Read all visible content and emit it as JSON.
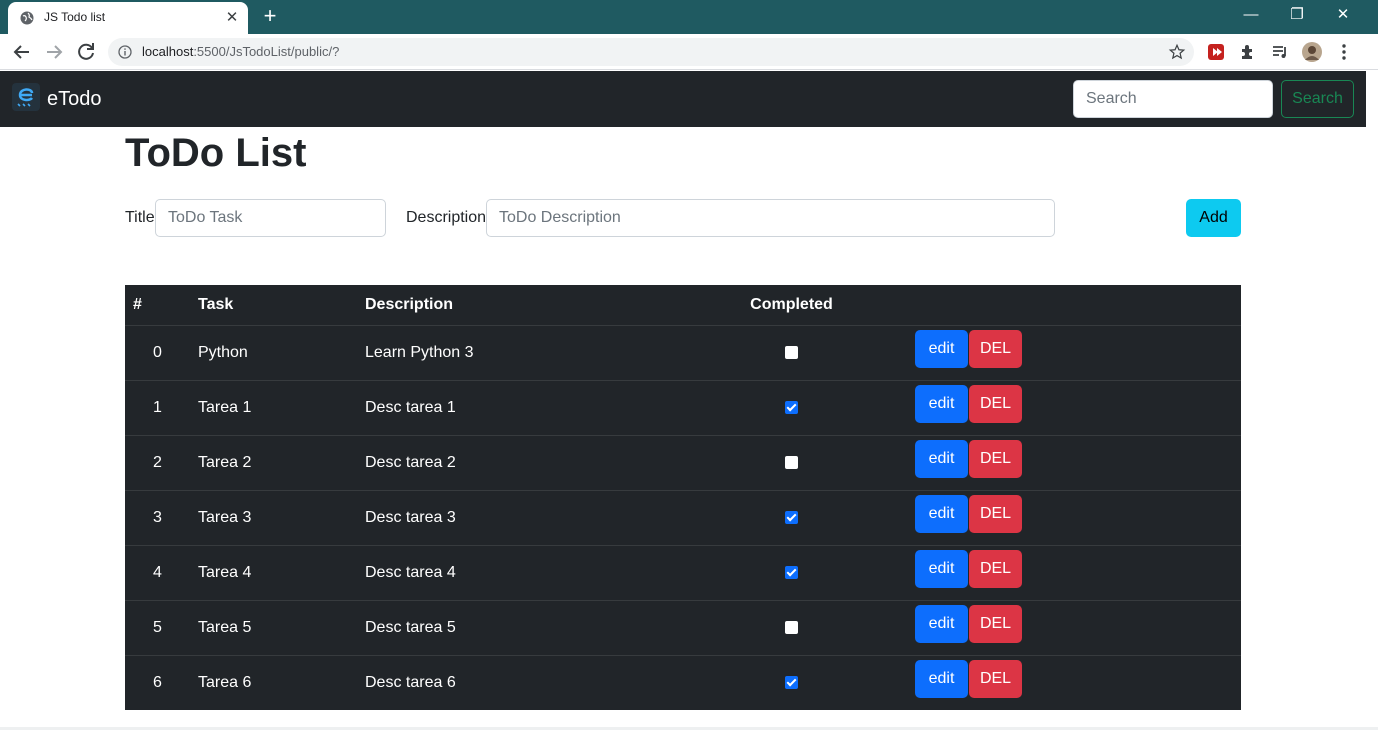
{
  "browser": {
    "tab_title": "JS Todo list",
    "url_host": "localhost",
    "url_rest": ":5500/JsTodoList/public/?",
    "new_tab": "+",
    "close_tab": "✕",
    "minimize": "—",
    "restore": "❐",
    "close_window": "✕"
  },
  "navbar": {
    "brand": "eTodo",
    "search_placeholder": "Search",
    "search_button": "Search"
  },
  "page": {
    "title": "ToDo List",
    "form": {
      "title_label": "Title",
      "title_placeholder": "ToDo Task",
      "desc_label": "Description",
      "desc_placeholder": "ToDo Description",
      "add_button": "Add"
    },
    "table": {
      "headers": [
        "#",
        "Task",
        "Description",
        "Completed"
      ],
      "edit_label": "edit",
      "del_label": "DEL",
      "rows": [
        {
          "id": "0",
          "task": "Python",
          "desc": "Learn Python 3",
          "completed": false
        },
        {
          "id": "1",
          "task": "Tarea 1",
          "desc": "Desc tarea 1",
          "completed": true
        },
        {
          "id": "2",
          "task": "Tarea 2",
          "desc": "Desc tarea 2",
          "completed": false
        },
        {
          "id": "3",
          "task": "Tarea 3",
          "desc": "Desc tarea 3",
          "completed": true
        },
        {
          "id": "4",
          "task": "Tarea 4",
          "desc": "Desc tarea 4",
          "completed": true
        },
        {
          "id": "5",
          "task": "Tarea 5",
          "desc": "Desc tarea 5",
          "completed": false
        },
        {
          "id": "6",
          "task": "Tarea 6",
          "desc": "Desc tarea 6",
          "completed": true
        }
      ]
    }
  },
  "colors": {
    "titlebar": "#1f5a61",
    "navbar": "#212529",
    "edit": "#0d6efd",
    "del": "#dc3545",
    "add": "#0dcaf0",
    "search_outline": "#198754"
  }
}
